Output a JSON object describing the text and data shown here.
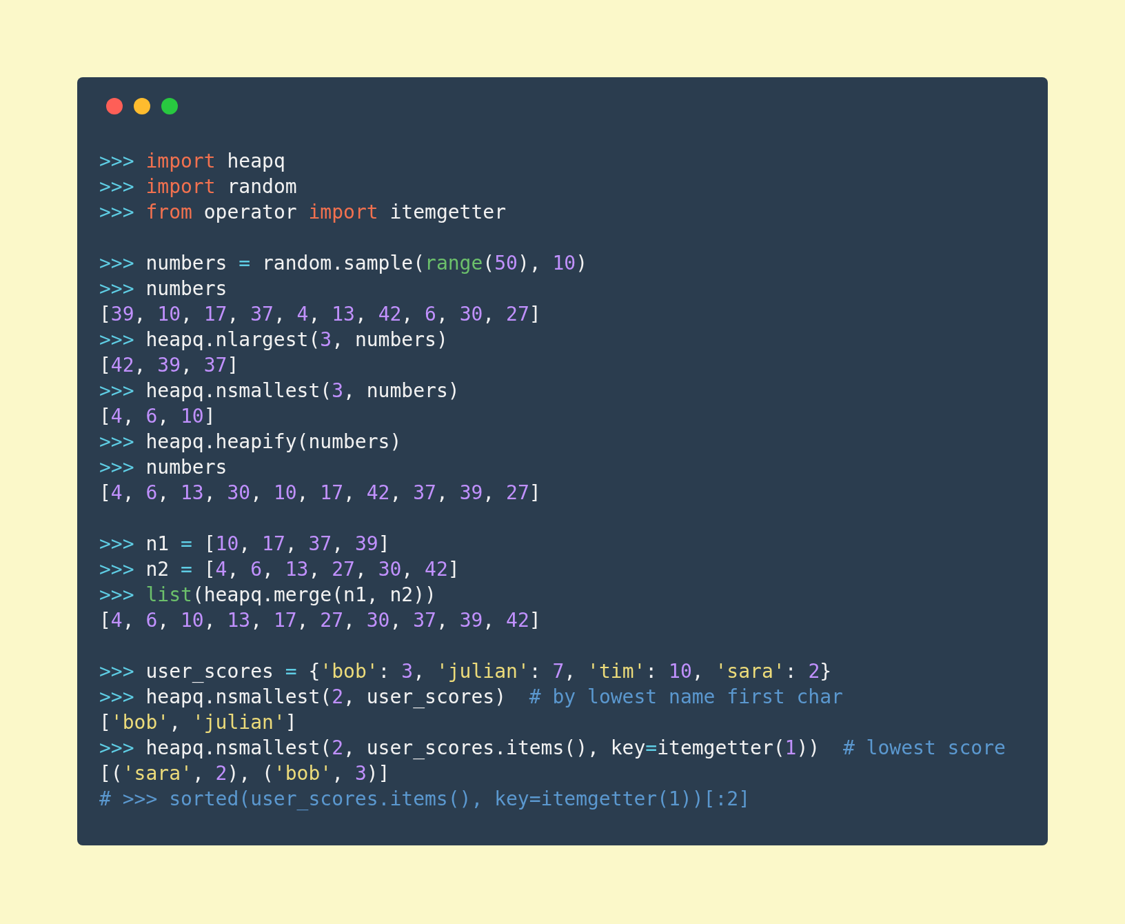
{
  "code_blocks": [
    {
      "lines": [
        {
          "tokens": [
            {
              "kind": "prompt",
              "text": ">>> "
            },
            {
              "kind": "keyword",
              "text": "import"
            },
            {
              "kind": "text",
              "text": " heapq"
            }
          ]
        },
        {
          "tokens": [
            {
              "kind": "prompt",
              "text": ">>> "
            },
            {
              "kind": "keyword",
              "text": "import"
            },
            {
              "kind": "text",
              "text": " random"
            }
          ]
        },
        {
          "tokens": [
            {
              "kind": "prompt",
              "text": ">>> "
            },
            {
              "kind": "keyword",
              "text": "from"
            },
            {
              "kind": "text",
              "text": " operator "
            },
            {
              "kind": "keyword",
              "text": "import"
            },
            {
              "kind": "text",
              "text": " itemgetter"
            }
          ]
        }
      ]
    },
    {
      "lines": [
        {
          "tokens": [
            {
              "kind": "prompt",
              "text": ">>> "
            },
            {
              "kind": "text",
              "text": "numbers "
            },
            {
              "kind": "op",
              "text": "="
            },
            {
              "kind": "text",
              "text": " random.sample("
            },
            {
              "kind": "builtin",
              "text": "range"
            },
            {
              "kind": "text",
              "text": "("
            },
            {
              "kind": "number",
              "text": "50"
            },
            {
              "kind": "text",
              "text": "), "
            },
            {
              "kind": "number",
              "text": "10"
            },
            {
              "kind": "text",
              "text": ")"
            }
          ]
        },
        {
          "tokens": [
            {
              "kind": "prompt",
              "text": ">>> "
            },
            {
              "kind": "text",
              "text": "numbers"
            }
          ]
        },
        {
          "tokens": [
            {
              "kind": "text",
              "text": "["
            },
            {
              "kind": "number",
              "text": "39"
            },
            {
              "kind": "text",
              "text": ", "
            },
            {
              "kind": "number",
              "text": "10"
            },
            {
              "kind": "text",
              "text": ", "
            },
            {
              "kind": "number",
              "text": "17"
            },
            {
              "kind": "text",
              "text": ", "
            },
            {
              "kind": "number",
              "text": "37"
            },
            {
              "kind": "text",
              "text": ", "
            },
            {
              "kind": "number",
              "text": "4"
            },
            {
              "kind": "text",
              "text": ", "
            },
            {
              "kind": "number",
              "text": "13"
            },
            {
              "kind": "text",
              "text": ", "
            },
            {
              "kind": "number",
              "text": "42"
            },
            {
              "kind": "text",
              "text": ", "
            },
            {
              "kind": "number",
              "text": "6"
            },
            {
              "kind": "text",
              "text": ", "
            },
            {
              "kind": "number",
              "text": "30"
            },
            {
              "kind": "text",
              "text": ", "
            },
            {
              "kind": "number",
              "text": "27"
            },
            {
              "kind": "text",
              "text": "]"
            }
          ]
        },
        {
          "tokens": [
            {
              "kind": "prompt",
              "text": ">>> "
            },
            {
              "kind": "text",
              "text": "heapq.nlargest("
            },
            {
              "kind": "number",
              "text": "3"
            },
            {
              "kind": "text",
              "text": ", numbers)"
            }
          ]
        },
        {
          "tokens": [
            {
              "kind": "text",
              "text": "["
            },
            {
              "kind": "number",
              "text": "42"
            },
            {
              "kind": "text",
              "text": ", "
            },
            {
              "kind": "number",
              "text": "39"
            },
            {
              "kind": "text",
              "text": ", "
            },
            {
              "kind": "number",
              "text": "37"
            },
            {
              "kind": "text",
              "text": "]"
            }
          ]
        },
        {
          "tokens": [
            {
              "kind": "prompt",
              "text": ">>> "
            },
            {
              "kind": "text",
              "text": "heapq.nsmallest("
            },
            {
              "kind": "number",
              "text": "3"
            },
            {
              "kind": "text",
              "text": ", numbers)"
            }
          ]
        },
        {
          "tokens": [
            {
              "kind": "text",
              "text": "["
            },
            {
              "kind": "number",
              "text": "4"
            },
            {
              "kind": "text",
              "text": ", "
            },
            {
              "kind": "number",
              "text": "6"
            },
            {
              "kind": "text",
              "text": ", "
            },
            {
              "kind": "number",
              "text": "10"
            },
            {
              "kind": "text",
              "text": "]"
            }
          ]
        },
        {
          "tokens": [
            {
              "kind": "prompt",
              "text": ">>> "
            },
            {
              "kind": "text",
              "text": "heapq.heapify(numbers)"
            }
          ]
        },
        {
          "tokens": [
            {
              "kind": "prompt",
              "text": ">>> "
            },
            {
              "kind": "text",
              "text": "numbers"
            }
          ]
        },
        {
          "tokens": [
            {
              "kind": "text",
              "text": "["
            },
            {
              "kind": "number",
              "text": "4"
            },
            {
              "kind": "text",
              "text": ", "
            },
            {
              "kind": "number",
              "text": "6"
            },
            {
              "kind": "text",
              "text": ", "
            },
            {
              "kind": "number",
              "text": "13"
            },
            {
              "kind": "text",
              "text": ", "
            },
            {
              "kind": "number",
              "text": "30"
            },
            {
              "kind": "text",
              "text": ", "
            },
            {
              "kind": "number",
              "text": "10"
            },
            {
              "kind": "text",
              "text": ", "
            },
            {
              "kind": "number",
              "text": "17"
            },
            {
              "kind": "text",
              "text": ", "
            },
            {
              "kind": "number",
              "text": "42"
            },
            {
              "kind": "text",
              "text": ", "
            },
            {
              "kind": "number",
              "text": "37"
            },
            {
              "kind": "text",
              "text": ", "
            },
            {
              "kind": "number",
              "text": "39"
            },
            {
              "kind": "text",
              "text": ", "
            },
            {
              "kind": "number",
              "text": "27"
            },
            {
              "kind": "text",
              "text": "]"
            }
          ]
        }
      ]
    },
    {
      "lines": [
        {
          "tokens": [
            {
              "kind": "prompt",
              "text": ">>> "
            },
            {
              "kind": "text",
              "text": "n1 "
            },
            {
              "kind": "op",
              "text": "="
            },
            {
              "kind": "text",
              "text": " ["
            },
            {
              "kind": "number",
              "text": "10"
            },
            {
              "kind": "text",
              "text": ", "
            },
            {
              "kind": "number",
              "text": "17"
            },
            {
              "kind": "text",
              "text": ", "
            },
            {
              "kind": "number",
              "text": "37"
            },
            {
              "kind": "text",
              "text": ", "
            },
            {
              "kind": "number",
              "text": "39"
            },
            {
              "kind": "text",
              "text": "]"
            }
          ]
        },
        {
          "tokens": [
            {
              "kind": "prompt",
              "text": ">>> "
            },
            {
              "kind": "text",
              "text": "n2 "
            },
            {
              "kind": "op",
              "text": "="
            },
            {
              "kind": "text",
              "text": " ["
            },
            {
              "kind": "number",
              "text": "4"
            },
            {
              "kind": "text",
              "text": ", "
            },
            {
              "kind": "number",
              "text": "6"
            },
            {
              "kind": "text",
              "text": ", "
            },
            {
              "kind": "number",
              "text": "13"
            },
            {
              "kind": "text",
              "text": ", "
            },
            {
              "kind": "number",
              "text": "27"
            },
            {
              "kind": "text",
              "text": ", "
            },
            {
              "kind": "number",
              "text": "30"
            },
            {
              "kind": "text",
              "text": ", "
            },
            {
              "kind": "number",
              "text": "42"
            },
            {
              "kind": "text",
              "text": "]"
            }
          ]
        },
        {
          "tokens": [
            {
              "kind": "prompt",
              "text": ">>> "
            },
            {
              "kind": "builtin",
              "text": "list"
            },
            {
              "kind": "text",
              "text": "(heapq.merge(n1, n2))"
            }
          ]
        },
        {
          "tokens": [
            {
              "kind": "text",
              "text": "["
            },
            {
              "kind": "number",
              "text": "4"
            },
            {
              "kind": "text",
              "text": ", "
            },
            {
              "kind": "number",
              "text": "6"
            },
            {
              "kind": "text",
              "text": ", "
            },
            {
              "kind": "number",
              "text": "10"
            },
            {
              "kind": "text",
              "text": ", "
            },
            {
              "kind": "number",
              "text": "13"
            },
            {
              "kind": "text",
              "text": ", "
            },
            {
              "kind": "number",
              "text": "17"
            },
            {
              "kind": "text",
              "text": ", "
            },
            {
              "kind": "number",
              "text": "27"
            },
            {
              "kind": "text",
              "text": ", "
            },
            {
              "kind": "number",
              "text": "30"
            },
            {
              "kind": "text",
              "text": ", "
            },
            {
              "kind": "number",
              "text": "37"
            },
            {
              "kind": "text",
              "text": ", "
            },
            {
              "kind": "number",
              "text": "39"
            },
            {
              "kind": "text",
              "text": ", "
            },
            {
              "kind": "number",
              "text": "42"
            },
            {
              "kind": "text",
              "text": "]"
            }
          ]
        }
      ]
    },
    {
      "lines": [
        {
          "tokens": [
            {
              "kind": "prompt",
              "text": ">>> "
            },
            {
              "kind": "text",
              "text": "user_scores "
            },
            {
              "kind": "op",
              "text": "="
            },
            {
              "kind": "text",
              "text": " {"
            },
            {
              "kind": "string",
              "text": "'bob'"
            },
            {
              "kind": "text",
              "text": ": "
            },
            {
              "kind": "number",
              "text": "3"
            },
            {
              "kind": "text",
              "text": ", "
            },
            {
              "kind": "string",
              "text": "'julian'"
            },
            {
              "kind": "text",
              "text": ": "
            },
            {
              "kind": "number",
              "text": "7"
            },
            {
              "kind": "text",
              "text": ", "
            },
            {
              "kind": "string",
              "text": "'tim'"
            },
            {
              "kind": "text",
              "text": ": "
            },
            {
              "kind": "number",
              "text": "10"
            },
            {
              "kind": "text",
              "text": ", "
            },
            {
              "kind": "string",
              "text": "'sara'"
            },
            {
              "kind": "text",
              "text": ": "
            },
            {
              "kind": "number",
              "text": "2"
            },
            {
              "kind": "text",
              "text": "}"
            }
          ]
        },
        {
          "tokens": [
            {
              "kind": "prompt",
              "text": ">>> "
            },
            {
              "kind": "text",
              "text": "heapq.nsmallest("
            },
            {
              "kind": "number",
              "text": "2"
            },
            {
              "kind": "text",
              "text": ", user_scores)  "
            },
            {
              "kind": "comment",
              "text": "# by lowest name first char"
            }
          ]
        },
        {
          "tokens": [
            {
              "kind": "text",
              "text": "["
            },
            {
              "kind": "string",
              "text": "'bob'"
            },
            {
              "kind": "text",
              "text": ", "
            },
            {
              "kind": "string",
              "text": "'julian'"
            },
            {
              "kind": "text",
              "text": "]"
            }
          ]
        },
        {
          "tokens": [
            {
              "kind": "prompt",
              "text": ">>> "
            },
            {
              "kind": "text",
              "text": "heapq.nsmallest("
            },
            {
              "kind": "number",
              "text": "2"
            },
            {
              "kind": "text",
              "text": ", user_scores.items(), key"
            },
            {
              "kind": "op",
              "text": "="
            },
            {
              "kind": "text",
              "text": "itemgetter("
            },
            {
              "kind": "number",
              "text": "1"
            },
            {
              "kind": "text",
              "text": "))  "
            },
            {
              "kind": "comment",
              "text": "# lowest score"
            }
          ]
        },
        {
          "tokens": [
            {
              "kind": "text",
              "text": "[("
            },
            {
              "kind": "string",
              "text": "'sara'"
            },
            {
              "kind": "text",
              "text": ", "
            },
            {
              "kind": "number",
              "text": "2"
            },
            {
              "kind": "text",
              "text": "), ("
            },
            {
              "kind": "string",
              "text": "'bob'"
            },
            {
              "kind": "text",
              "text": ", "
            },
            {
              "kind": "number",
              "text": "3"
            },
            {
              "kind": "text",
              "text": ")]"
            }
          ]
        },
        {
          "tokens": [
            {
              "kind": "comment",
              "text": "# >>> sorted(user_scores.items(), key=itemgetter(1))[:2]"
            }
          ]
        }
      ]
    }
  ]
}
